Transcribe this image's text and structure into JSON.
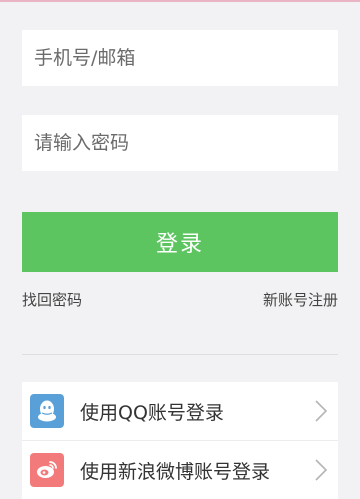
{
  "login_form": {
    "account_placeholder": "手机号/邮箱",
    "password_placeholder": "请输入密码",
    "login_button": "登录"
  },
  "links": {
    "forgot_password": "找回密码",
    "register": "新账号注册"
  },
  "third_party": [
    {
      "label": "使用QQ账号登录",
      "icon": "qq-icon",
      "color": "#5aa0d8"
    },
    {
      "label": "使用新浪微博账号登录",
      "icon": "weibo-icon",
      "color": "#f27a7a"
    }
  ],
  "colors": {
    "primary": "#5cc55f",
    "background": "#f2f2f4"
  }
}
